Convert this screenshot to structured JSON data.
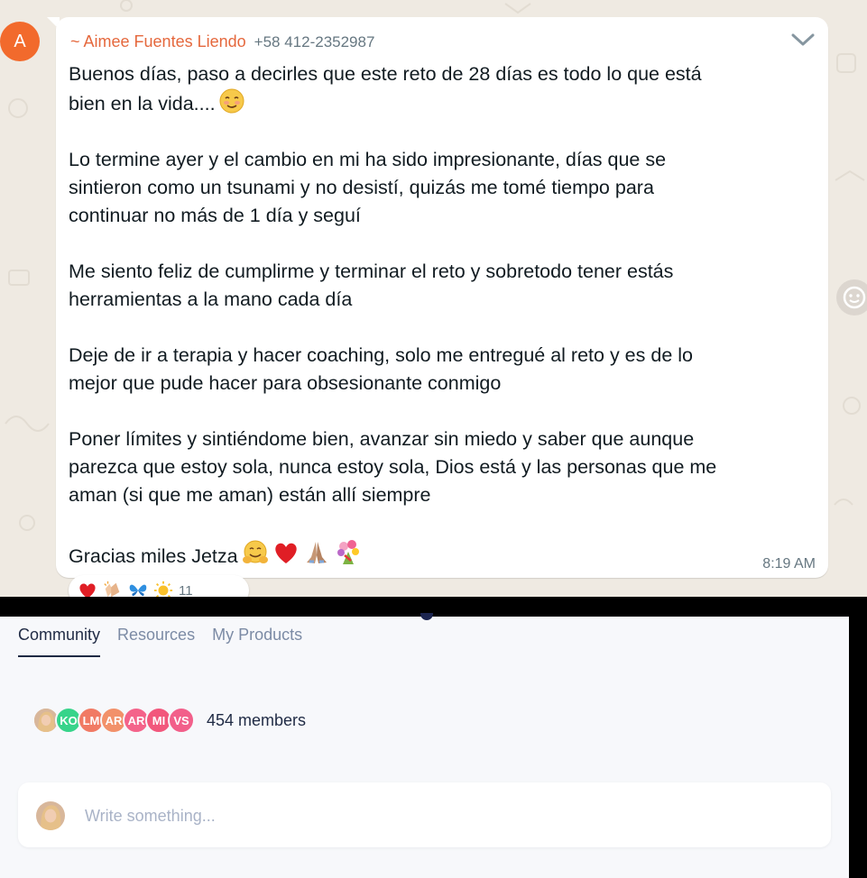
{
  "chat": {
    "avatar_letter": "A",
    "sender_name": "~ Aimee Fuentes Liendo",
    "sender_phone": "+58 412-2352987",
    "paragraphs": [
      "Buenos días, paso a decirles que este reto de 28 días es todo lo que está\nbien en la vida....",
      "Lo termine ayer y el cambio en mi ha sido impresionante, días que se\nsintieron como un tsunami y no desistí, quizás me tomé tiempo para\ncontinuar no más de 1 día y seguí",
      "Me siento feliz de cumplirme y terminar el reto y sobretodo tener estás\nherramientas a la mano cada día",
      "Deje de ir a terapia y hacer coaching, solo me entregué al reto y es de lo\nmejor que pude hacer para obsesionante conmigo",
      "Poner límites y sintiéndome bien, avanzar sin miedo y saber que aunque\nparezca que estoy sola, nunca estoy sola, Dios está y las personas que me\naman (si que me aman) están allí siempre",
      "Gracias miles Jetza"
    ],
    "paragraph1_emoji": "smiling-face-icon",
    "closing_emojis": [
      "hugging-face-icon",
      "red-heart-icon",
      "folded-hands-icon",
      "bouquet-icon"
    ],
    "timestamp": "8:19 AM",
    "reactions": [
      "red-heart-icon",
      "clapping-hands-icon",
      "butterfly-icon",
      "sun-icon"
    ],
    "reaction_count": "11",
    "colors": {
      "background": "#efeae2",
      "sender": "#e5683d",
      "avatar": "#f26a2c"
    }
  },
  "community": {
    "tabs": [
      {
        "label": "Community",
        "active": true
      },
      {
        "label": "Resources",
        "active": false
      },
      {
        "label": "My Products",
        "active": false
      }
    ],
    "member_avatars": [
      {
        "initials": "",
        "color": "#e9b99a",
        "photo": true
      },
      {
        "initials": "KO",
        "color": "#37d48a"
      },
      {
        "initials": "LM",
        "color": "#f17a64"
      },
      {
        "initials": "AR",
        "color": "#f2916a"
      },
      {
        "initials": "AR",
        "color": "#f4638a"
      },
      {
        "initials": "MI",
        "color": "#f2577c"
      },
      {
        "initials": "VS",
        "color": "#f25f8a"
      }
    ],
    "members_label": "454 members",
    "composer_placeholder": "Write something...",
    "colors": {
      "active_tab": "#1f2a44",
      "inactive_tab": "#7c8ba5"
    }
  }
}
